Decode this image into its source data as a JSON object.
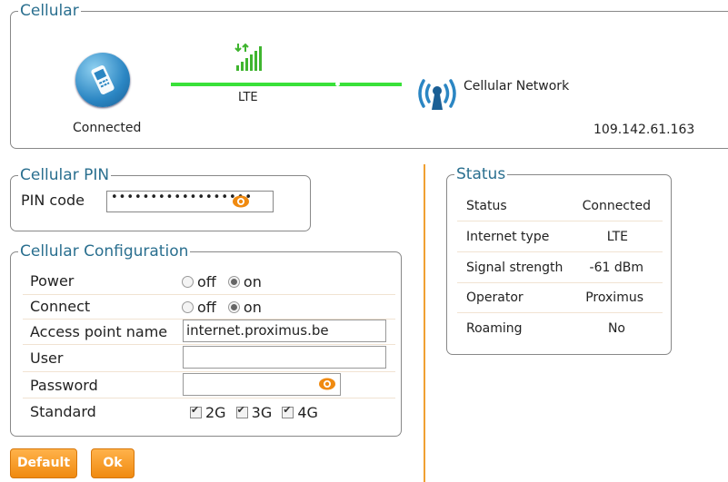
{
  "cellular": {
    "legend": "Cellular",
    "device_status": "Connected",
    "link_type": "LTE",
    "network_label": "Cellular Network",
    "ip_address": "109.142.61.163"
  },
  "pin": {
    "legend": "Cellular PIN",
    "label": "PIN code",
    "value_masked": "••••••••••••••••••"
  },
  "config": {
    "legend": "Cellular Configuration",
    "power": {
      "label": "Power",
      "off": "off",
      "on": "on",
      "selected": "on"
    },
    "connect": {
      "label": "Connect",
      "off": "off",
      "on": "on",
      "selected": "on"
    },
    "apn": {
      "label": "Access point name",
      "value": "internet.proximus.be"
    },
    "user": {
      "label": "User",
      "value": ""
    },
    "password": {
      "label": "Password",
      "value": ""
    },
    "standard": {
      "label": "Standard",
      "opt_2g": "2G",
      "opt_3g": "3G",
      "opt_4g": "4G"
    }
  },
  "status": {
    "legend": "Status",
    "rows": [
      {
        "label": "Status",
        "value": "Connected"
      },
      {
        "label": "Internet type",
        "value": "LTE"
      },
      {
        "label": "Signal strength",
        "value": "-61 dBm"
      },
      {
        "label": "Operator",
        "value": "Proximus"
      },
      {
        "label": "Roaming",
        "value": "No"
      }
    ]
  },
  "buttons": {
    "default": "Default",
    "ok": "Ok"
  },
  "colors": {
    "accent": "#f08a10",
    "legend": "#2a6f8f",
    "link": "#39e139",
    "signal": "#3fb52f"
  }
}
